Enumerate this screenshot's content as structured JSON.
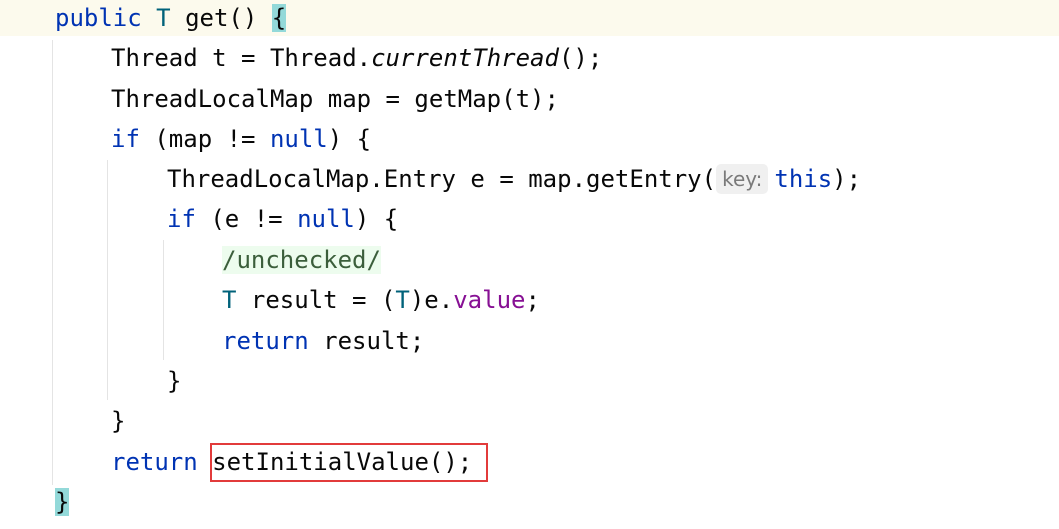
{
  "editor": {
    "lines": {
      "l1": {
        "kw_public": "public",
        "type_t": "T",
        "method": "get()",
        "brace": "{"
      },
      "l2": {
        "part1": "Thread t = Thread.",
        "italic": "currentThread",
        "part2": "();"
      },
      "l3": {
        "text": "ThreadLocalMap map = getMap(t);"
      },
      "l4": {
        "kw_if": "if",
        "part1": " (map != ",
        "kw_null": "null",
        "part2": ") {"
      },
      "l5": {
        "part1": "ThreadLocalMap.Entry e = map.getEntry(",
        "hint": "key:",
        "kw_this": "this",
        "part2": ");"
      },
      "l6": {
        "kw_if": "if",
        "part1": " (e != ",
        "kw_null": "null",
        "part2": ") {"
      },
      "l7": {
        "comment": "/unchecked/"
      },
      "l8": {
        "type_t": "T",
        "part1": " result = (",
        "type_t2": "T",
        "part2": ")e.",
        "field": "value",
        "part3": ";"
      },
      "l9": {
        "kw_return": "return",
        "part1": " result;"
      },
      "l10": {
        "brace": "}"
      },
      "l11": {
        "brace": "}"
      },
      "l12": {
        "kw_return": "return",
        "part1": " setInitialValue();"
      },
      "l13": {
        "brace": "}"
      }
    }
  }
}
